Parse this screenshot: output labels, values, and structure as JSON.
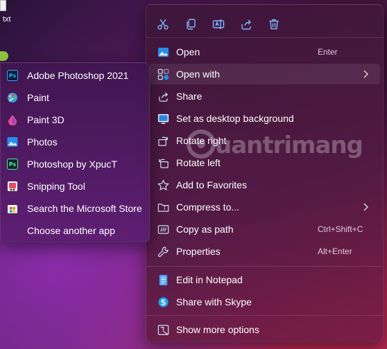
{
  "desktop": {
    "file_label": "txt"
  },
  "watermark": "uantrimang",
  "context_menu": {
    "toolbar": [
      "cut-icon",
      "copy-icon",
      "rename-icon",
      "share-icon",
      "delete-icon"
    ],
    "items": [
      {
        "label": "Open",
        "shortcut": "Enter",
        "icon": "open-icon"
      },
      {
        "label": "Open with",
        "shortcut": "",
        "icon": "open-with-icon",
        "submenu": true
      },
      {
        "label": "Share",
        "shortcut": "",
        "icon": "share-icon"
      },
      {
        "label": "Set as desktop background",
        "shortcut": "",
        "icon": "desktop-background-icon"
      },
      {
        "label": "Rotate right",
        "shortcut": "",
        "icon": "rotate-right-icon"
      },
      {
        "label": "Rotate left",
        "shortcut": "",
        "icon": "rotate-left-icon"
      },
      {
        "label": "Add to Favorites",
        "shortcut": "",
        "icon": "star-icon"
      },
      {
        "label": "Compress to...",
        "shortcut": "",
        "icon": "zip-folder-icon",
        "submenu": true
      },
      {
        "label": "Copy as path",
        "shortcut": "Ctrl+Shift+C",
        "icon": "copy-path-icon"
      },
      {
        "label": "Properties",
        "shortcut": "Alt+Enter",
        "icon": "wrench-icon"
      },
      {
        "label": "Edit in Notepad",
        "shortcut": "",
        "icon": "notepad-icon"
      },
      {
        "label": "Share with Skype",
        "shortcut": "",
        "icon": "skype-icon"
      },
      {
        "label": "Show more options",
        "shortcut": "",
        "icon": "more-options-icon"
      }
    ]
  },
  "open_with_submenu": {
    "items": [
      {
        "label": "Adobe Photoshop 2021",
        "icon": "photoshop-icon"
      },
      {
        "label": "Paint",
        "icon": "paint-icon"
      },
      {
        "label": "Paint 3D",
        "icon": "paint-3d-icon"
      },
      {
        "label": "Photos",
        "icon": "photos-icon"
      },
      {
        "label": "Photoshop by XpucT",
        "icon": "photoshop-xpuct-icon"
      },
      {
        "label": "Snipping Tool",
        "icon": "snipping-tool-icon"
      },
      {
        "label": "Search the Microsoft Store",
        "icon": "store-icon"
      },
      {
        "label": "Choose another app",
        "icon": ""
      }
    ]
  }
}
